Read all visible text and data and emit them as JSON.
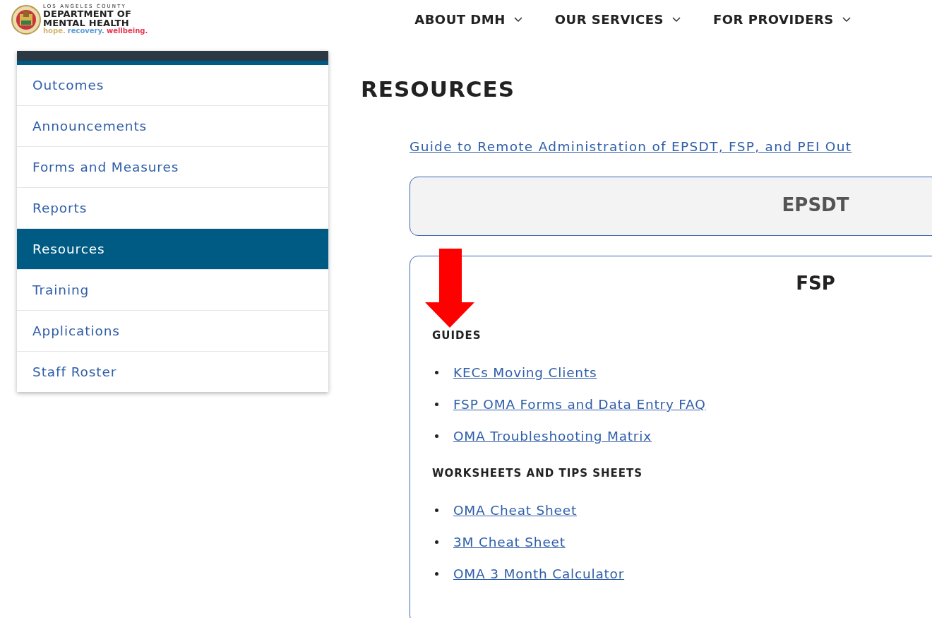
{
  "header": {
    "logo": {
      "county": "LOS ANGELES COUNTY",
      "name_lines": [
        "DEPARTMENT OF",
        "MENTAL HEALTH"
      ],
      "tagline": [
        {
          "text": "hope.",
          "color": "#d2b46a"
        },
        {
          "text": "recovery.",
          "color": "#5b9bd5"
        },
        {
          "text": "wellbeing.",
          "color": "#e8344e"
        }
      ]
    },
    "nav": [
      {
        "label": "ABOUT DMH"
      },
      {
        "label": "OUR SERVICES"
      },
      {
        "label": "FOR PROVIDERS"
      }
    ]
  },
  "sidebar": {
    "items": [
      {
        "label": "Outcomes",
        "selected": false
      },
      {
        "label": "Announcements",
        "selected": false
      },
      {
        "label": "Forms and Measures",
        "selected": false
      },
      {
        "label": "Reports",
        "selected": false
      },
      {
        "label": "Resources",
        "selected": true
      },
      {
        "label": "Training",
        "selected": false
      },
      {
        "label": "Applications",
        "selected": false
      },
      {
        "label": "Staff Roster",
        "selected": false
      }
    ]
  },
  "page": {
    "title": "RESOURCES",
    "intro_link": "Guide to Remote Administration of EPSDT, FSP, and PEI Out",
    "sections": [
      {
        "title": "EPSDT",
        "expanded": false
      },
      {
        "title": "FSP",
        "expanded": true,
        "annotation": {
          "kind": "arrow-down"
        },
        "groups": [
          {
            "heading": "GUIDES",
            "links": [
              "KECs Moving Clients",
              "FSP OMA Forms and Data Entry FAQ",
              "OMA Troubleshooting Matrix"
            ]
          },
          {
            "heading": "WORKSHEETS AND TIPS SHEETS",
            "links": [
              "OMA Cheat Sheet",
              "3M Cheat Sheet",
              "OMA 3 Month Calculator"
            ]
          }
        ]
      }
    ]
  }
}
